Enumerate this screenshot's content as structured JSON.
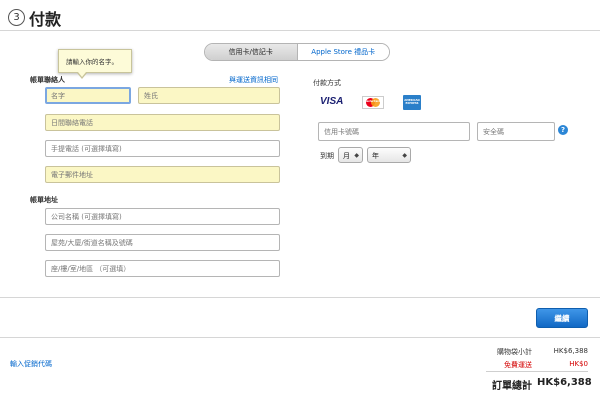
{
  "step": {
    "number": "3",
    "title": "付款"
  },
  "tabs": {
    "card": "信用卡/信記卡",
    "gift": "Apple Store 禮品卡"
  },
  "billing": {
    "contact_label": "帳單聯絡人",
    "same_as_shipping": "與運送資訊相同",
    "tooltip": "請輸入你的名字。",
    "first_name_placeholder": "名字",
    "last_name_placeholder": "姓氏",
    "day_phone_placeholder": "日間聯絡電話",
    "mobile_placeholder": "手提電話 (可選擇填寫)",
    "email_placeholder": "電子郵件地址",
    "address_label": "帳單地址",
    "company_placeholder": "公司名稱 (可選擇填寫)",
    "street_placeholder": "屋苑/大廈/街道名稱及號碼",
    "unit_placeholder": "座/樓/室/地區 （可選填）"
  },
  "payment": {
    "label": "付款方式",
    "brands": {
      "visa": "VISA",
      "mastercard": "MasterCard",
      "amex": "AMERICAN EXPRESS"
    },
    "card_number_placeholder": "信用卡號碼",
    "security_code_placeholder": "安全碼",
    "expiry_label": "到期",
    "month_value": "月",
    "year_value": "年",
    "help": "?"
  },
  "continue_label": "繼續",
  "promo_link": "輸入促銷代碼",
  "summary": {
    "subtotal_label": "購物袋小計",
    "subtotal_value": "HK$6,388",
    "shipping_label": "免費運送",
    "shipping_value": "HK$0",
    "total_label": "訂單總計",
    "total_value": "HK$6,388"
  },
  "colors": {
    "accent": "#0066cc",
    "highlight_field": "#fbf7c5",
    "continue_button": "#1a74d0",
    "free_shipping": "#d40000"
  },
  "icons": {
    "step": "circled-number-icon",
    "help": "question-icon",
    "dropdown": "chevron-down-icon"
  }
}
